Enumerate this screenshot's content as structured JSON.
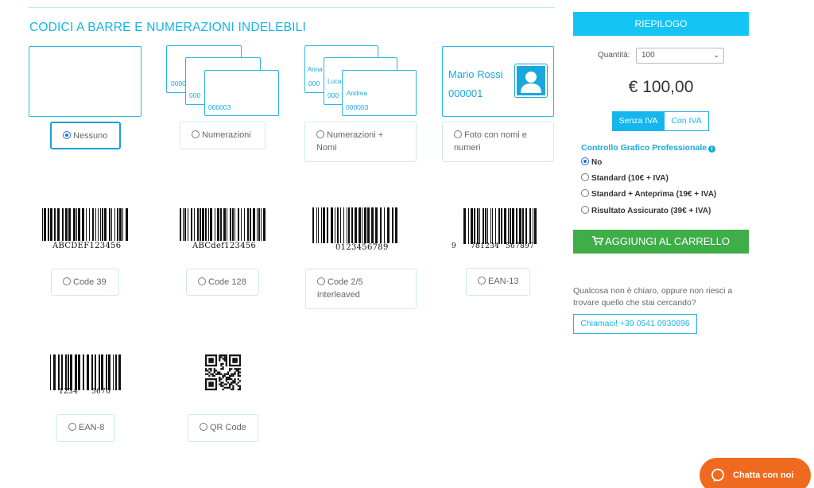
{
  "section": {
    "title": "CODICI A BARRE E NUMERAZIONI INDELEBILI"
  },
  "cards": {
    "numerazioni": [
      "0000",
      "000",
      "000003"
    ],
    "nomi_names": [
      "Anna",
      "Luca",
      "Andrea"
    ],
    "nomi_nums": [
      "000",
      "000",
      "000003"
    ],
    "foto": {
      "name": "Mario Rossi",
      "number": "000001"
    }
  },
  "options": {
    "nessuno": "Nessuno",
    "numerazioni": "Numerazioni",
    "numerazioni_nomi_1": "Numerazioni +",
    "numerazioni_nomi_2": "Nomi",
    "foto_1": "Foto con nomi e",
    "foto_2": "numeri",
    "code39": "Code 39",
    "code128": "Code 128",
    "code25_1": "Code 2/5",
    "code25_2": "interleaved",
    "ean13": "EAN-13",
    "ean8": "EAN-8",
    "qr": "QR Code",
    "selected": "Nessuno"
  },
  "barcodes": {
    "code39": "ABCDEF123456",
    "code128": "ABCdef123456",
    "code25": "0123456789",
    "ean13_a": "9",
    "ean13_b": "781234",
    "ean13_c": "567897",
    "ean8_a": "1234",
    "ean8_b": "5670"
  },
  "summary": {
    "title": "RIEPILOGO",
    "qty_label": "Quantità:",
    "qty_value": "100",
    "price": "€ 100,00",
    "iva_excl": "Senza IVA",
    "iva_incl": "Con IVA",
    "cg_title": "Controllo Grafico Professionale",
    "cg_options": [
      "No",
      "Standard (10€ + IVA)",
      "Standard + Anteprima (19€ + IVA)",
      "Risultato Assicurato (39€ + IVA)"
    ],
    "cg_selected": "No",
    "cart_button": "AGGIUNGI AL CARRELLO",
    "help_text_1": "Qualcosa non è chiaro, oppure non riesci a",
    "help_text_2": "trovare quello che stai cercando?",
    "call_button": "Chiamaci! +39 0541 0930896"
  },
  "chat": {
    "label": "Chatta con noi"
  },
  "colors": {
    "accent": "#14c4f2",
    "cart": "#3fae49",
    "chat": "#ef6a1f"
  },
  "icons": [
    "user-silhouette-icon",
    "shopping-cart-icon",
    "info-icon",
    "chat-bubble-icon",
    "chevron-down-icon"
  ]
}
